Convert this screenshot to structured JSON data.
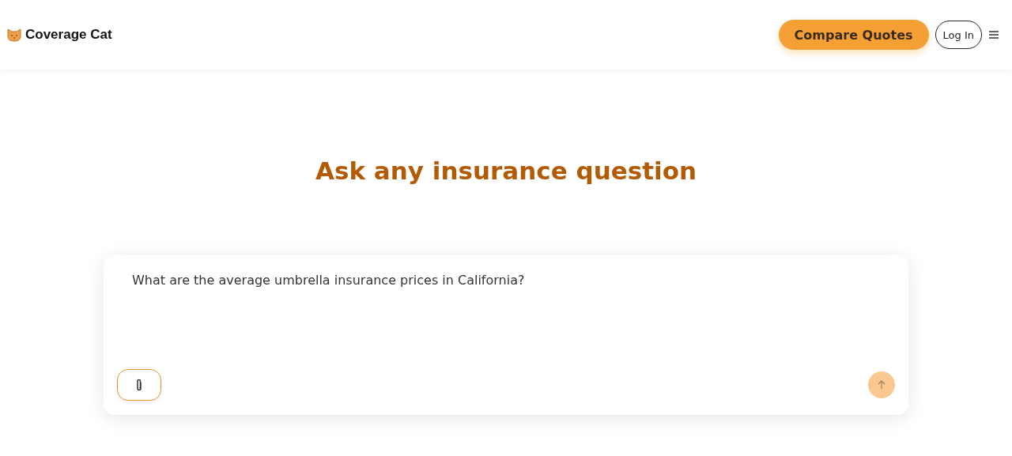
{
  "header": {
    "brand": "Coverage Cat",
    "cta": "Compare Quotes",
    "login": "Log In"
  },
  "heading": "Ask any insurance question",
  "composer": {
    "value": "What are the average umbrella insurance prices in California?",
    "send_disabled": true
  }
}
